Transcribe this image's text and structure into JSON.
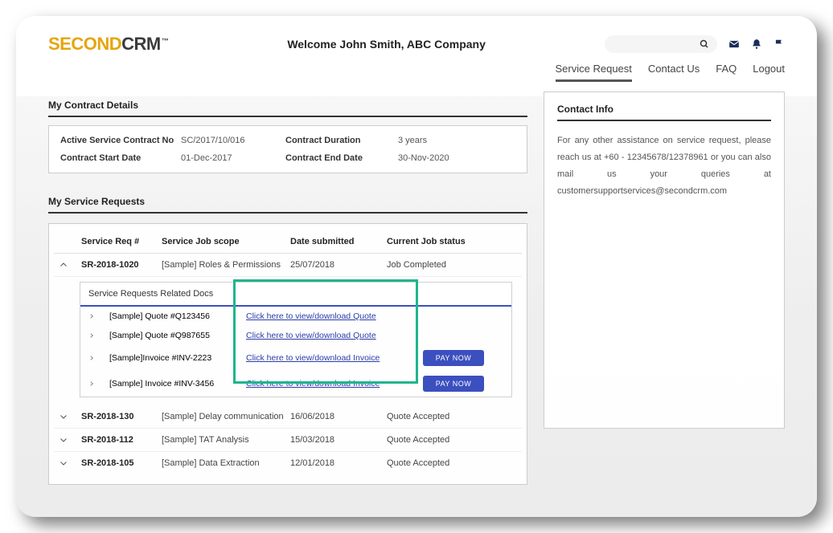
{
  "logo": {
    "part1": "SECOND",
    "part2": "CRM",
    "tm": "™"
  },
  "welcome": "Welcome John Smith, ABC Company",
  "nav": {
    "items": [
      "Service Request",
      "Contact Us",
      "FAQ",
      "Logout"
    ],
    "active_index": 0
  },
  "contract": {
    "title": "My Contract Details",
    "fields": {
      "no_label": "Active Service Contract No",
      "no_value": "SC/2017/10/016",
      "duration_label": "Contract Duration",
      "duration_value": "3 years",
      "start_label": "Contract Start Date",
      "start_value": "01-Dec-2017",
      "end_label": "Contract End Date",
      "end_value": "30-Nov-2020"
    }
  },
  "requests": {
    "title": "My Service Requests",
    "columns": [
      "Service Req #",
      "Service Job scope",
      "Date submitted",
      "Current Job status"
    ],
    "rows": [
      {
        "id": "SR-2018-1020",
        "scope": "[Sample] Roles & Permissions",
        "date": "25/07/2018",
        "status": "Job Completed",
        "expanded": true
      },
      {
        "id": "SR-2018-130",
        "scope": "[Sample] Delay communication",
        "date": "16/06/2018",
        "status": "Quote Accepted",
        "expanded": false
      },
      {
        "id": "SR-2018-112",
        "scope": "[Sample] TAT Analysis",
        "date": "15/03/2018",
        "status": "Quote Accepted",
        "expanded": false
      },
      {
        "id": "SR-2018-105",
        "scope": "[Sample] Data Extraction",
        "date": "12/01/2018",
        "status": "Quote Accepted",
        "expanded": false
      }
    ],
    "docs_header": "Service Requests Related Docs",
    "docs": [
      {
        "name": "[Sample] Quote #Q123456",
        "link_text": "Click here to view/download Quote",
        "pay": false
      },
      {
        "name": "[Sample] Quote #Q987655",
        "link_text": "Click here to view/download Quote",
        "pay": false
      },
      {
        "name": "[Sample]Invoice #INV-2223",
        "link_text": "Click here to view/download Invoice",
        "pay": true
      },
      {
        "name": "[Sample] Invoice #INV-3456",
        "link_text": "Click here to view/download Invoice",
        "pay": true
      }
    ],
    "pay_label": "PAY NOW"
  },
  "contact": {
    "title": "Contact Info",
    "body": "For any other assistance on service request, please reach us at +60 - 12345678/12378961 or you can also mail us your queries at customersupportservices@secondcrm.com"
  }
}
